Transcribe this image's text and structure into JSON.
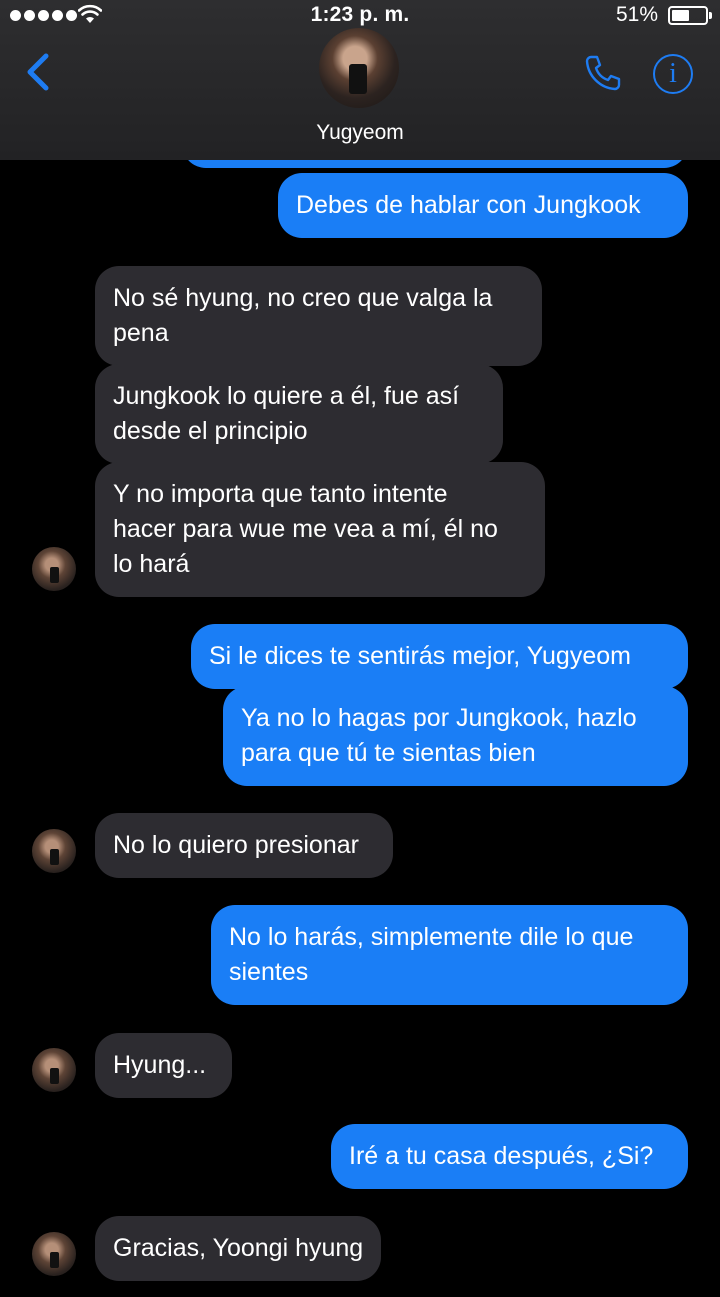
{
  "status_bar": {
    "time": "1:23 p. m.",
    "battery_percent": "51%",
    "battery_level": 0.51,
    "signal_bars": 5
  },
  "header": {
    "contact_name": "Yugyeom",
    "back_icon": "chevron-left-icon",
    "call_icon": "phone-icon",
    "info_icon": "info-icon",
    "info_glyph": "i",
    "accent_color": "#1e7cf2"
  },
  "colors": {
    "outgoing_bubble": "#1a7ef6",
    "incoming_bubble": "#2d2c31",
    "background": "#000000"
  },
  "messages": [
    {
      "from": "me",
      "lines": [
        "Debes de hablar con Jungkook"
      ]
    },
    {
      "from": "them",
      "lines": [
        "No sé hyung, no creo que valga la",
        "pena"
      ]
    },
    {
      "from": "them",
      "lines": [
        "Jungkook lo quiere a él, fue así",
        "desde el principio"
      ]
    },
    {
      "from": "them",
      "lines": [
        "Y no importa que tanto intente",
        "hacer para wue me vea a mí, él no",
        "lo hará"
      ]
    },
    {
      "from": "me",
      "lines": [
        "Si le dices te sentirás mejor, Yugyeom"
      ]
    },
    {
      "from": "me",
      "lines": [
        "Ya no lo hagas por Jungkook, hazlo",
        "para que tú te sientas bien"
      ]
    },
    {
      "from": "them",
      "lines": [
        "No lo quiero presionar"
      ]
    },
    {
      "from": "me",
      "lines": [
        "No lo harás, simplemente dile lo que",
        "sientes"
      ]
    },
    {
      "from": "them",
      "lines": [
        "Hyung..."
      ]
    },
    {
      "from": "me",
      "lines": [
        "Iré a tu casa después, ¿Si?"
      ]
    },
    {
      "from": "them",
      "lines": [
        "Gracias, Yoongi hyung"
      ]
    }
  ]
}
